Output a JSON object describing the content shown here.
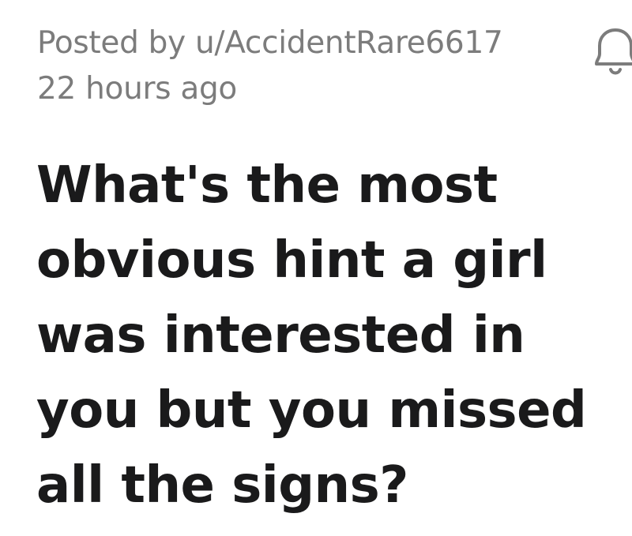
{
  "post": {
    "posted_by": "Posted by u/AccidentRare6617",
    "time_ago": "22 hours ago",
    "title": "What's the most obvious hint a girl was interested in you but you missed all the signs?"
  },
  "icons": {
    "notify": "bell-icon"
  },
  "colors": {
    "meta_text": "#7c7c7c",
    "title_text": "#1a1a1b",
    "background": "#ffffff"
  }
}
